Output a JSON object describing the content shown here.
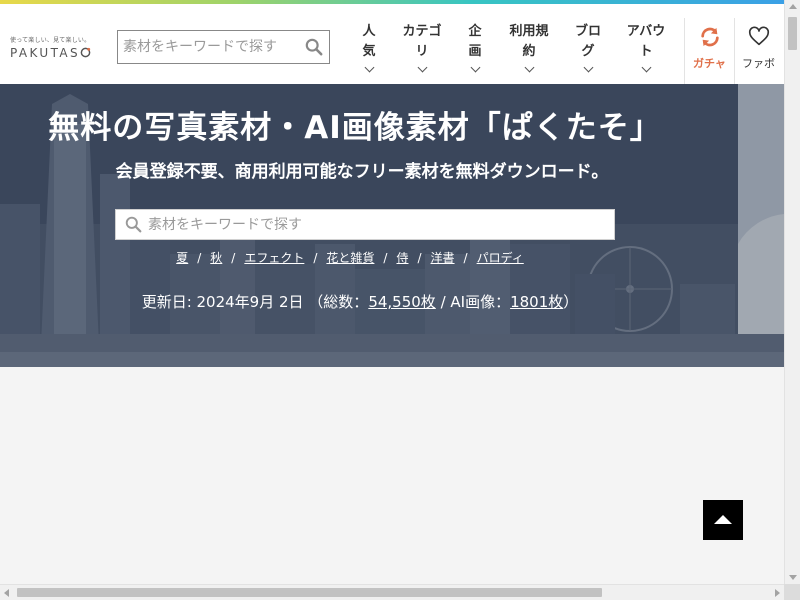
{
  "header": {
    "logo_tagline": "使って楽しい、見て楽しい。",
    "logo_text": "PAKUTAS",
    "search_placeholder": "素材をキーワードで探す",
    "nav": [
      {
        "label": "人\n気"
      },
      {
        "label": "カテゴ\nリ"
      },
      {
        "label": "企\n画"
      },
      {
        "label": "利用規\n約"
      },
      {
        "label": "ブロ\nグ"
      },
      {
        "label": "アバウ\nト"
      }
    ],
    "gacha_label": "ガチャ",
    "fav_label": "ファボ"
  },
  "hero": {
    "title": "無料の写真素材・AI画像素材「ぱくたそ」",
    "subtitle": "会員登録不要、商用利用可能なフリー素材を無料ダウンロード。",
    "search_placeholder": "素材をキーワードで探す",
    "tags": [
      "夏",
      "秋",
      "エフェクト",
      "花と雑貨",
      "侍",
      "洋書",
      "パロディ"
    ],
    "tag_separator": "/",
    "updated_prefix": "更新日: 2024年9月 2日 （総数：",
    "total_count": "54,550枚",
    "ai_prefix": " / AI画像：",
    "ai_count": "1801枚",
    "updated_suffix": "）"
  },
  "colors": {
    "accent": "#e0704a",
    "stripe": [
      "#e8d84a",
      "#9ed36a",
      "#38c5c2",
      "#3aa0e6"
    ],
    "hero_overlay": "#3e4a5e"
  },
  "icons": {
    "header_search": "search-icon",
    "gacha": "refresh-icon",
    "fav": "heart-icon",
    "to_top": "arrow-up-icon"
  }
}
